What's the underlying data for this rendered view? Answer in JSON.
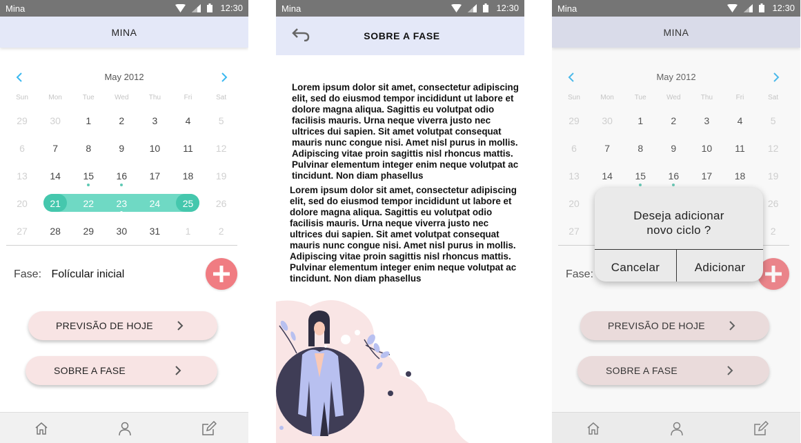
{
  "status_bar": {
    "app_name": "Mina",
    "time": "12:30"
  },
  "screen1": {
    "title": "MINA",
    "calendar": {
      "month_label": "May 2012",
      "weekdays": [
        "Sun",
        "Mon",
        "Tue",
        "Wed",
        "Thu",
        "Fri",
        "Sat"
      ],
      "weeks": [
        [
          {
            "d": "29",
            "m": true
          },
          {
            "d": "30",
            "m": true
          },
          {
            "d": "1"
          },
          {
            "d": "2"
          },
          {
            "d": "3"
          },
          {
            "d": "4"
          },
          {
            "d": "5",
            "m": true
          }
        ],
        [
          {
            "d": "6",
            "m": true
          },
          {
            "d": "7"
          },
          {
            "d": "8"
          },
          {
            "d": "9"
          },
          {
            "d": "10"
          },
          {
            "d": "11"
          },
          {
            "d": "12",
            "m": true
          }
        ],
        [
          {
            "d": "13",
            "m": true
          },
          {
            "d": "14"
          },
          {
            "d": "15",
            "dot": true
          },
          {
            "d": "16",
            "dot": true
          },
          {
            "d": "17"
          },
          {
            "d": "18"
          },
          {
            "d": "19",
            "m": true
          }
        ],
        [
          {
            "d": "20",
            "m": true
          },
          {
            "d": "21",
            "s": true
          },
          {
            "d": "22",
            "s": true
          },
          {
            "d": "23",
            "s": true,
            "dot": true
          },
          {
            "d": "24",
            "s": true
          },
          {
            "d": "25",
            "s": true
          },
          {
            "d": "26",
            "m": true
          }
        ],
        [
          {
            "d": "27",
            "m": true
          },
          {
            "d": "28"
          },
          {
            "d": "29"
          },
          {
            "d": "30"
          },
          {
            "d": "31"
          },
          {
            "d": "1",
            "m": true
          },
          {
            "d": "2",
            "m": true
          }
        ]
      ]
    },
    "phase_label": "Fase:",
    "phase_value": "Folícular inicial",
    "btn_forecast": "PREVISÃO DE HOJE",
    "btn_about": "SOBRE A FASE"
  },
  "screen2": {
    "title": "SOBRE A FASE",
    "paragraphs": [
      "Lorem ipsum dolor sit amet, consectetur adipiscing elit, sed do eiusmod tempor incididunt ut labore et dolore magna aliqua. Sagittis eu volutpat odio facilisis mauris. Urna neque viverra justo nec ultrices dui sapien. Sit amet volutpat consequat mauris nunc congue nisi. Amet nisl purus in mollis. Adipiscing vitae proin sagittis nisl rhoncus mattis. Pulvinar elementum integer enim neque volutpat ac tincidunt. Non diam phasellus",
      "Lorem ipsum dolor sit amet, consectetur adipiscing elit, sed do eiusmod tempor incididunt ut labore et dolore magna aliqua. Sagittis eu volutpat odio facilisis mauris. Urna neque viverra justo nec ultrices dui sapien. Sit amet volutpat consequat mauris nunc congue nisi. Amet nisl purus in mollis. Adipiscing vitae proin sagittis nisl rhoncus mattis. Pulvinar elementum integer enim neque volutpat ac tincidunt. Non diam phasellus"
    ]
  },
  "screen3": {
    "dialog": {
      "message_line1": "Deseja adicionar",
      "message_line2": "novo ciclo ?",
      "cancel_label": "Cancelar",
      "confirm_label": "Adicionar"
    }
  },
  "colors": {
    "appbar": "#e4e8f8",
    "range": "#6fd9c4",
    "range_cap": "#45c7ad",
    "fab": "#f07c82",
    "pill": "#f8e4e4",
    "arrow": "#3bb8f0"
  },
  "icons": {
    "status": [
      "wifi-icon",
      "signal-icon",
      "battery-icon"
    ],
    "calendar": [
      "chevron-left-icon",
      "chevron-right-icon"
    ],
    "nav": [
      "home-icon",
      "profile-icon",
      "edit-icon"
    ],
    "fab": "plus-icon",
    "back": "back-arrow-icon"
  }
}
